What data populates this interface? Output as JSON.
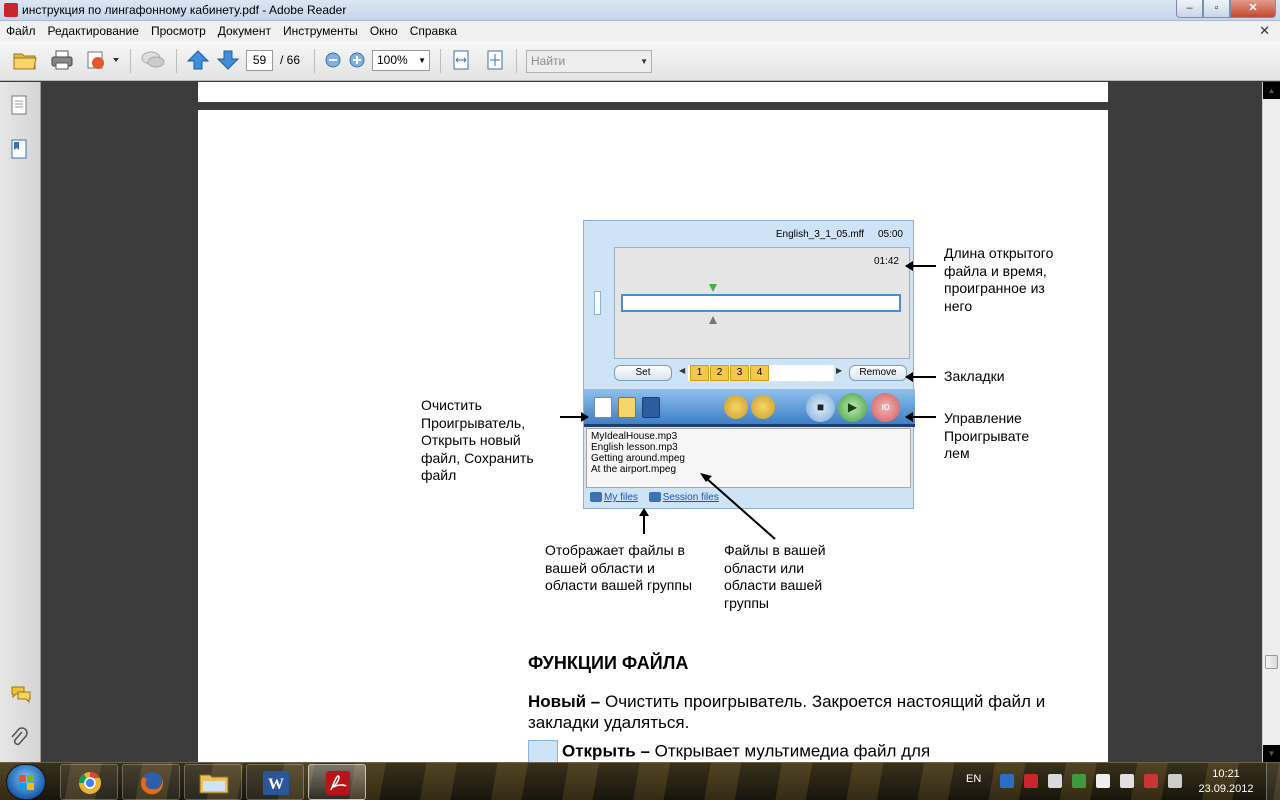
{
  "window": {
    "title": "инструкция по лингафонному кабинету.pdf - Adobe Reader",
    "minimize": "–",
    "maximize": "▫",
    "close": "✕"
  },
  "menu": {
    "items": [
      "Файл",
      "Редактирование",
      "Просмотр",
      "Документ",
      "Инструменты",
      "Окно",
      "Справка"
    ],
    "close_glyph": "✕"
  },
  "toolbar": {
    "page_current": "59",
    "page_total": "/ 66",
    "zoom": "100%",
    "find_placeholder": "Найти"
  },
  "player": {
    "file_name": "English_3_1_05.mff",
    "file_length": "05:00",
    "elapsed": "01:42",
    "set_label": "Set",
    "remove_label": "Remove",
    "bookmarks": [
      "1",
      "2",
      "3",
      "4"
    ],
    "stop_glyph": "■",
    "play_glyph": "▶",
    "rec_glyph": "ю",
    "files": [
      "MyIdealHouse.mp3",
      "English lesson.mp3",
      "Getting around.mpeg",
      "At the airport.mpeg"
    ],
    "tab_my_files": "My files",
    "tab_session_files": "Session files"
  },
  "annotations": {
    "length_and_time": "Длина открытого файла и время, проигранное из него",
    "bookmarks": "Закладки",
    "player_control": "Управление Проигрывате лем",
    "clear_open_save": "Очистить Проигрыватель, Открыть новый файл, Сохранить файл",
    "shows_files": "Отображает файлы в вашей области и области вашей группы",
    "files_in_area": "Файлы в вашей области или области вашей группы"
  },
  "content": {
    "section_title": "ФУНКЦИИ ФАЙЛА",
    "new_label": "Новый –",
    "new_text": " Очистить проигрыватель. Закроется настоящий файл и закладки удаляться.",
    "open_label": "Открыть –",
    "open_text": " Открывает мультимедиа файл для"
  },
  "taskbar": {
    "language": "EN",
    "time": "10:21",
    "date": "23.09.2012"
  }
}
